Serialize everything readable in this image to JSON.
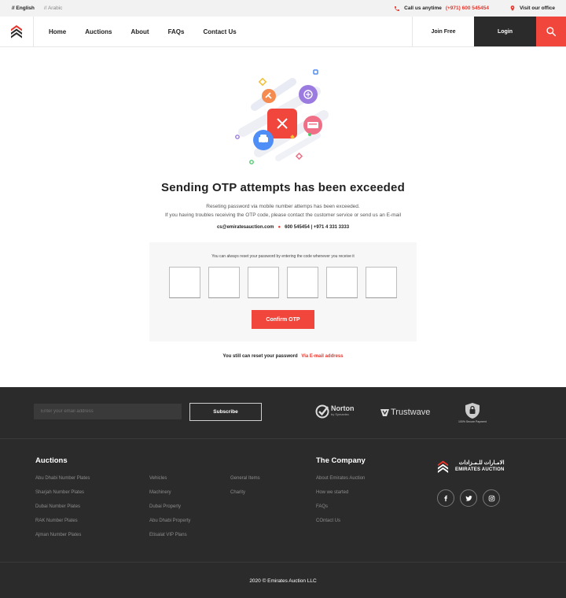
{
  "topbar": {
    "lang_english": "// English",
    "lang_arabic": "// Arabic",
    "call_label": "Call us anytime",
    "call_number": "(+971) 600 545454",
    "visit_label": "Visit our office"
  },
  "nav": {
    "items": [
      "Home",
      "Auctions",
      "About",
      "FAQs",
      "Contact Us"
    ],
    "join_label": "Join Free",
    "login_label": "Login"
  },
  "main": {
    "heading": "Sending OTP attempts has been exceeded",
    "desc_line1": "Reseting password via mobile number attemps has been exceeded.",
    "desc_line2": "If you having troubles receiving the OTP code, please contact the customer service or send us an E-mail",
    "email": "cs@emiratesauction.com",
    "phones": "600 545454 | +971 4 331 3333"
  },
  "otp": {
    "hint": "You can always reset your password by entering the code whenever you receive it",
    "confirm_label": "Confirm OTP"
  },
  "reset": {
    "text": "You still can reset your password",
    "link": "Via E-mail address"
  },
  "footer": {
    "email_placeholder": "Enter your email address",
    "subscribe_label": "Subscribe",
    "norton_label": "Norton",
    "norton_sub": "by Symantec",
    "trustwave_label": "Trustwave",
    "secure_label": "100% Secure Payment",
    "auctions_title": "Auctions",
    "col1": [
      "Abu Dhabi Number Plates",
      "Sharjah Number Plates",
      "Dubai Number Plates",
      "RAK Number Plates",
      "Ajman Number Plates"
    ],
    "col2": [
      "Vehicles",
      "Machinery",
      "Dubai Property",
      "Abu Dhabi Property",
      "Etisalat VIP Plans"
    ],
    "col3": [
      "General Items",
      "Charity"
    ],
    "company_title": "The Company",
    "company": [
      "About Emirates Auction",
      "How we started",
      "FAQs",
      "COntact Us"
    ],
    "brand_ar": "الامـارات للـمـزادات",
    "brand_en": "EMIRATES AUCTION",
    "copyright": "2020 © Emirates Auction LLC"
  },
  "colors": {
    "accent": "#f0463b",
    "dark": "#2b2b2b"
  }
}
